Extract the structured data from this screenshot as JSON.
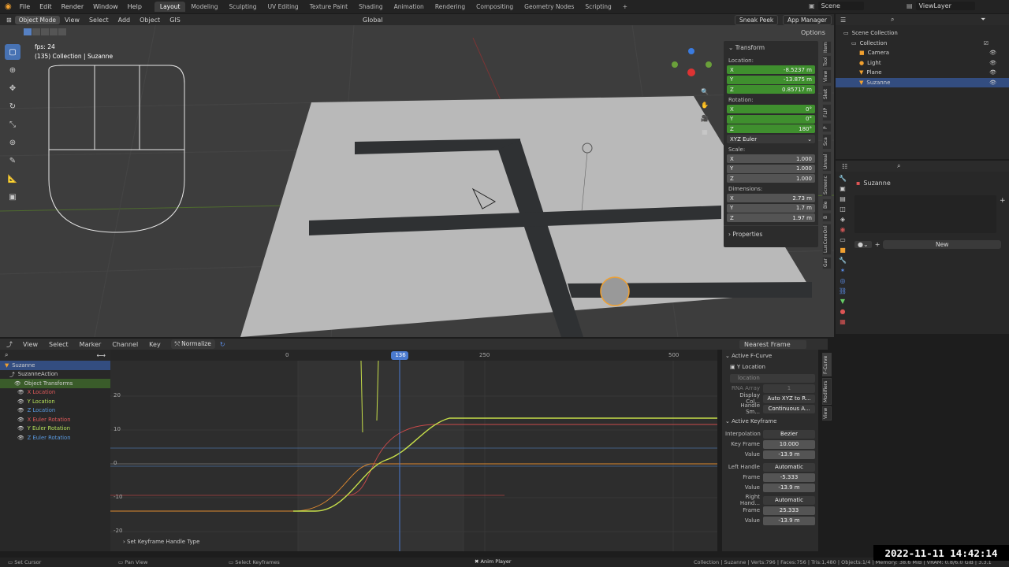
{
  "app": {
    "menu": [
      "File",
      "Edit",
      "Render",
      "Window",
      "Help"
    ],
    "workspaces": [
      "Layout",
      "Modeling",
      "Sculpting",
      "UV Editing",
      "Texture Paint",
      "Shading",
      "Animation",
      "Rendering",
      "Compositing",
      "Geometry Nodes",
      "Scripting"
    ],
    "active_workspace": "Layout",
    "plus": "+",
    "scene": "Scene",
    "view_layer": "ViewLayer"
  },
  "viewport": {
    "mode": "Object Mode",
    "menus": [
      "View",
      "Select",
      "Add",
      "Object",
      "GIS"
    ],
    "orientation": "Global",
    "sneak_peek": "Sneak Peek",
    "app_manager": "App Manager",
    "options": "Options",
    "fps": "fps: 24",
    "info": "(135) Collection | Suzanne"
  },
  "npanel": {
    "transform": "Transform",
    "location": "Location:",
    "rotation": "Rotation:",
    "scale": "Scale:",
    "dimensions": "Dimensions:",
    "loc": [
      {
        "a": "X",
        "v": "-8.5237 m"
      },
      {
        "a": "Y",
        "v": "-13.875 m"
      },
      {
        "a": "Z",
        "v": "0.85717 m"
      }
    ],
    "rot": [
      {
        "a": "X",
        "v": "0°"
      },
      {
        "a": "Y",
        "v": "0°"
      },
      {
        "a": "Z",
        "v": "180°"
      }
    ],
    "euler": "XYZ Euler",
    "scl": [
      {
        "a": "X",
        "v": "1.000"
      },
      {
        "a": "Y",
        "v": "1.000"
      },
      {
        "a": "Z",
        "v": "1.000"
      }
    ],
    "dim": [
      {
        "a": "X",
        "v": "2.73 m"
      },
      {
        "a": "Y",
        "v": "1.7 m"
      },
      {
        "a": "Z",
        "v": "1.97 m"
      }
    ],
    "properties": "Properties",
    "tabs": [
      "Item",
      "Tool",
      "View",
      "Sket",
      "FLIP",
      "P",
      "Sca",
      "Unreal",
      "Screenc",
      "Ble",
      "B",
      "LuxCoreOnl",
      "Gar"
    ]
  },
  "outliner": {
    "scene_collection": "Scene Collection",
    "collection": "Collection",
    "items": [
      "Camera",
      "Light",
      "Plane",
      "Suzanne"
    ]
  },
  "props": {
    "object": "Suzanne",
    "new": "New",
    "plus": "+"
  },
  "graph": {
    "menus": [
      "View",
      "Select",
      "Marker",
      "Channel",
      "Key"
    ],
    "normalize": "Normalize",
    "snap": "Nearest Frame",
    "frames": [
      "0",
      "136",
      "250",
      "500"
    ],
    "current": "136",
    "yticks": [
      "20",
      "10",
      "0",
      "-10",
      "-20"
    ],
    "channels": {
      "object": "Suzanne",
      "action": "SuzanneAction",
      "group": "Object Transforms",
      "items": [
        "X Location",
        "Y Location",
        "Z Location",
        "X Euler Rotation",
        "Y Euler Rotation",
        "Z Euler Rotation"
      ]
    },
    "operator": "Set Keyframe Handle Type"
  },
  "fcurve": {
    "active_fcurve": "Active F-Curve",
    "name": "Y Location",
    "path": "location",
    "rna_label": "RNA Array",
    "rna_val": "1",
    "display_color_label": "Display Col...",
    "display_color": "Auto XYZ to R...",
    "handle_smoothing_label": "Handle Sm...",
    "handle_smoothing": "Continuous A...",
    "active_keyframe": "Active Keyframe",
    "interp_label": "Interpolation",
    "interp": "Bezier",
    "key_frame_label": "Key Frame",
    "key_frame": "10.000",
    "value_label": "Value",
    "value": "-13.9 m",
    "left_handle_label": "Left Handle",
    "left_handle": "Automatic",
    "lh_frame_label": "Frame",
    "lh_frame": "-5.333",
    "lh_value_label": "Value",
    "lh_value": "-13.9 m",
    "right_handle_label": "Right Hand...",
    "right_handle": "Automatic",
    "rh_frame_label": "Frame",
    "rh_frame": "25.333",
    "rh_value_label": "Value",
    "rh_value": "-13.9 m",
    "tabs": [
      "F-Curve",
      "Modifiers",
      "View"
    ]
  },
  "status": {
    "set_cursor": "Set Cursor",
    "pan_view": "Pan View",
    "select_keyframes": "Select Keyframes",
    "anim_player": "Anim Player",
    "stats": "Collection | Suzanne | Verts:796 | Faces:756 | Tris:1,480 | Objects:1/4 | Memory: 38.6 MiB | VRAM: 0.8/6.0 GiB | 3.3.1"
  },
  "timestamp": "2022-11-11  14:42:14"
}
